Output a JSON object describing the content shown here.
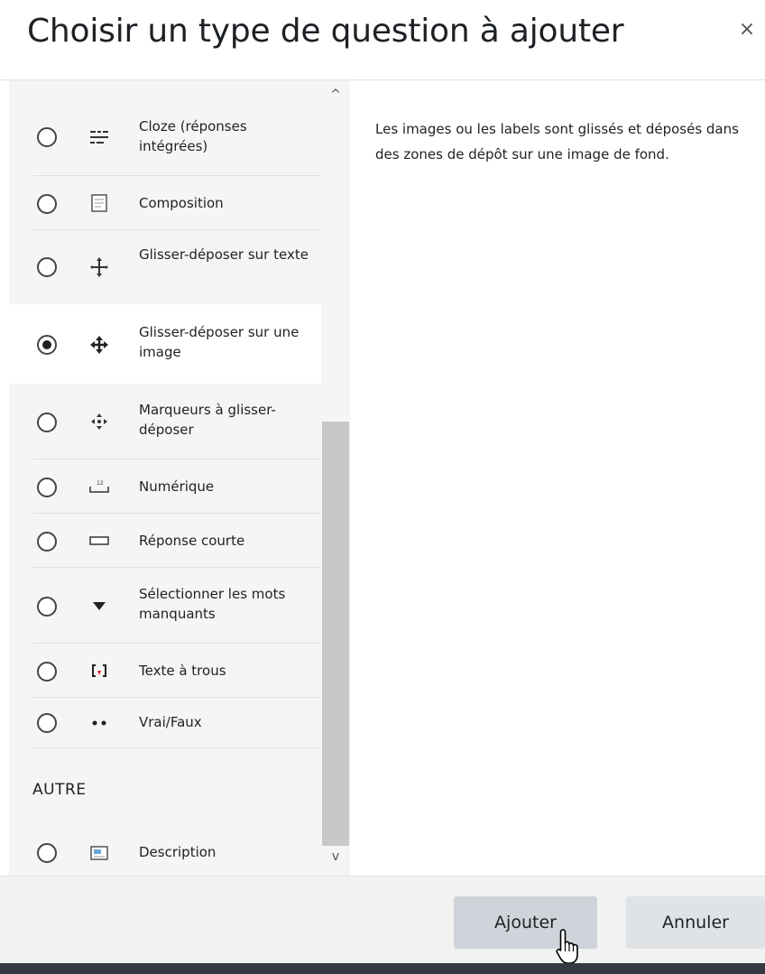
{
  "dialog": {
    "title": "Choisir un type de question à ajouter",
    "close_glyph": "×"
  },
  "options": [
    {
      "label": "Cloze (réponses intégrées)",
      "icon": "cloze-icon",
      "selected": false
    },
    {
      "label": "Composition",
      "icon": "essay-icon",
      "selected": false
    },
    {
      "label": "Glisser-déposer sur texte",
      "icon": "drag-text-icon",
      "selected": false
    },
    {
      "label": "Glisser-déposer sur une image",
      "icon": "drag-image-icon",
      "selected": true
    },
    {
      "label": "Marqueurs à glisser-déposer",
      "icon": "drag-markers-icon",
      "selected": false
    },
    {
      "label": "Numérique",
      "icon": "numerical-icon",
      "selected": false
    },
    {
      "label": "Réponse courte",
      "icon": "short-answer-icon",
      "selected": false
    },
    {
      "label": "Sélectionner les mots manquants",
      "icon": "dropdown-icon",
      "selected": false
    },
    {
      "label": "Texte à trous",
      "icon": "gap-fill-icon",
      "selected": false
    },
    {
      "label": "Vrai/Faux",
      "icon": "true-false-icon",
      "selected": false
    }
  ],
  "other_section": {
    "title": "AUTRE",
    "items": [
      {
        "label": "Description",
        "icon": "description-icon",
        "selected": false
      }
    ]
  },
  "description": "Les images ou les labels sont glissés et déposés dans des zones de dépôt sur une image de fond.",
  "buttons": {
    "add": "Ajouter",
    "cancel": "Annuler"
  },
  "scrollbar": {
    "up_glyph": "^",
    "down_glyph": "v"
  },
  "colors": {
    "list_background": "#f5f5f5",
    "selected_background": "#ffffff",
    "primary_button": "#ced4da",
    "footer": "#f2f2f2"
  }
}
